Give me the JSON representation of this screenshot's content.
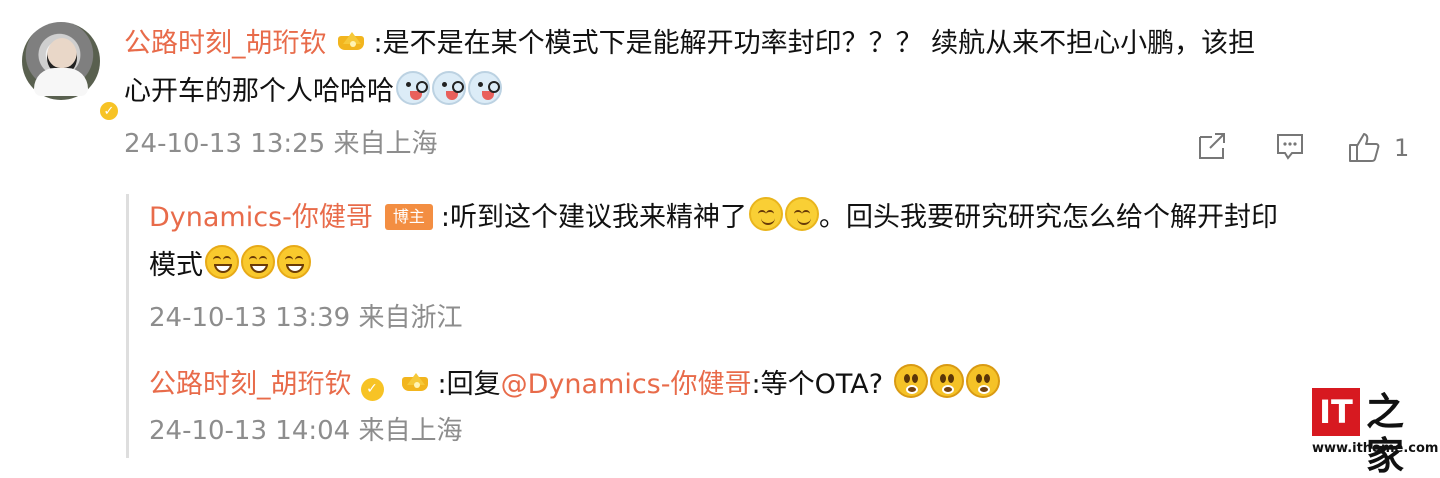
{
  "main_comment": {
    "username": "公路时刻_胡珩钦",
    "line1_text": ":是不是在某个模式下是能解开功率封印？？？ 续航从来不担心小鹏，该担",
    "line2_text": "心开车的那个人哈哈哈",
    "meta": "24-10-13 13:25 来自上海",
    "like_count": "1",
    "emojis": [
      "funny-face-icon",
      "funny-face-icon",
      "funny-face-icon"
    ]
  },
  "reply1": {
    "username": "Dynamics-你健哥",
    "badge": "博主",
    "line1_text": ":听到这个建议我来精神了",
    "line1_after": "。回头我要研究研究怎么给个解开封印",
    "line2_text": "模式",
    "meta": "24-10-13 13:39 来自浙江",
    "emojis_line1": [
      "smile-face-icon",
      "smile-face-icon"
    ],
    "emojis_line2": [
      "grin-face-icon",
      "grin-face-icon",
      "grin-face-icon"
    ]
  },
  "reply2": {
    "username": "公路时刻_胡珩钦",
    "before_mention": ":回复",
    "mention": "@Dynamics-你健哥",
    "after_mention": ":等个OTA?",
    "meta": "24-10-13 14:04 来自上海",
    "emojis": [
      "shocked-face-icon",
      "shocked-face-icon",
      "shocked-face-icon"
    ]
  },
  "watermark": {
    "logo_text": "IT",
    "home_text": "之家",
    "url": "www.ithome.com"
  },
  "icons": {
    "share": "share-icon",
    "comment": "comment-icon",
    "like": "thumbs-up-icon",
    "verify": "verified-icon",
    "crown": "crown-badge-icon"
  },
  "colors": {
    "username": "#e86b4a",
    "meta": "#8d8d8d",
    "badge": "#f38e42",
    "watermark_red": "#d71920"
  }
}
